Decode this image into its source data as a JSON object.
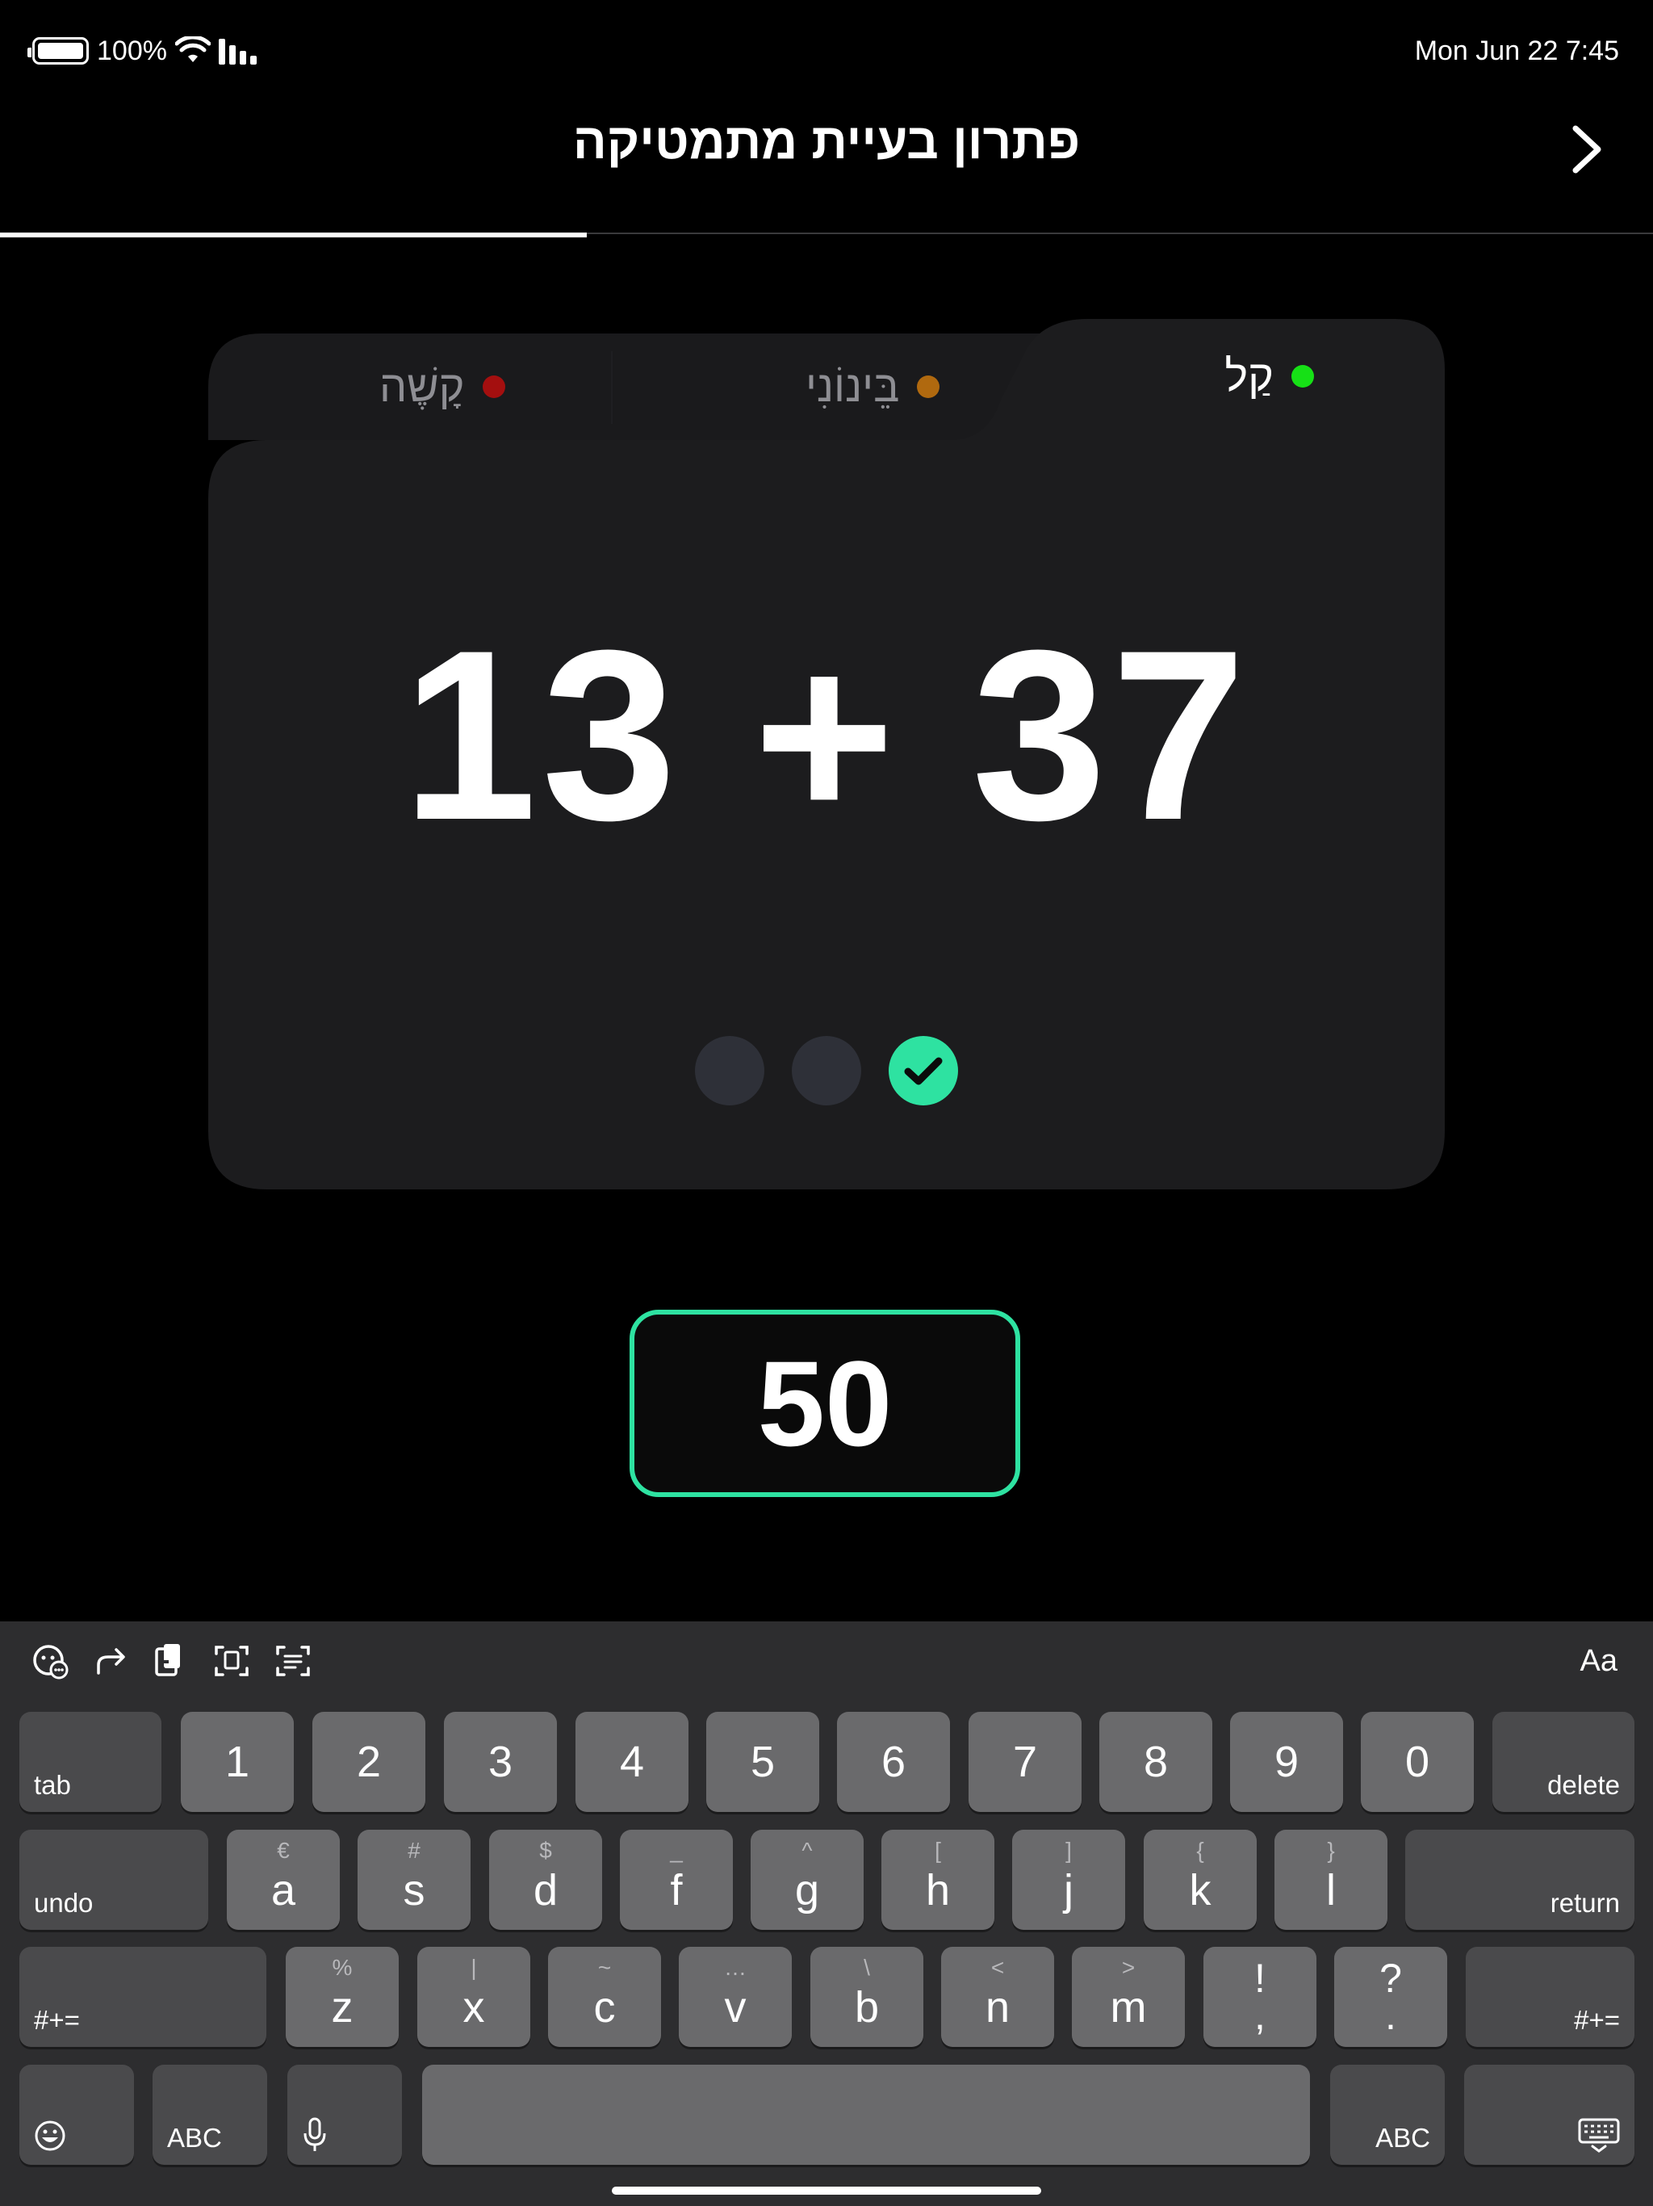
{
  "status_bar": {
    "battery": "100%",
    "date_time": "Mon Jun 22  7:45"
  },
  "header": {
    "title": "פתרון בעיית מתמטיקה"
  },
  "progress": {
    "fraction": 0.355
  },
  "tabs": [
    {
      "label": "קַל",
      "color": "#16e016",
      "active": true
    },
    {
      "label": "בֵּינוֹנִי",
      "color": "#b0690f",
      "active": false
    },
    {
      "label": "קָשֶׁה",
      "color": "#a40f0f",
      "active": false
    }
  ],
  "problem": {
    "text": "13 + 37"
  },
  "attempts": {
    "total": 3,
    "completed": 1,
    "accent": "#2ee2a1"
  },
  "answer": {
    "value": "50"
  },
  "keyboard": {
    "toolbar_icons": [
      "undo-emoji-icon",
      "redo-icon",
      "paste-icon",
      "scan-text-icon",
      "text-format-icon"
    ],
    "toolbar_right": "Aa",
    "row1": {
      "left": "tab",
      "keys": [
        "1",
        "2",
        "3",
        "4",
        "5",
        "6",
        "7",
        "8",
        "9",
        "0"
      ],
      "right": "delete"
    },
    "row2": {
      "left": "undo",
      "keys": [
        {
          "sub": "€",
          "main": "a"
        },
        {
          "sub": "#",
          "main": "s"
        },
        {
          "sub": "$",
          "main": "d"
        },
        {
          "sub": "_",
          "main": "f"
        },
        {
          "sub": "^",
          "main": "g"
        },
        {
          "sub": "[",
          "main": "h"
        },
        {
          "sub": "]",
          "main": "j"
        },
        {
          "sub": "{",
          "main": "k"
        },
        {
          "sub": "}",
          "main": "l"
        }
      ],
      "right": "return"
    },
    "row3": {
      "left": "#+=",
      "keys": [
        {
          "sub": "%",
          "main": "z"
        },
        {
          "sub": "|",
          "main": "x"
        },
        {
          "sub": "~",
          "main": "c"
        },
        {
          "sub": "…",
          "main": "v"
        },
        {
          "sub": "\\",
          "main": "b"
        },
        {
          "sub": "<",
          "main": "n"
        },
        {
          "sub": ">",
          "main": "m"
        }
      ],
      "punct": [
        {
          "top": "!",
          "bottom": ","
        },
        {
          "top": "?",
          "bottom": "."
        }
      ],
      "right": "#+="
    },
    "row4": {
      "abc_left": "ABC",
      "abc_right": "ABC"
    }
  }
}
